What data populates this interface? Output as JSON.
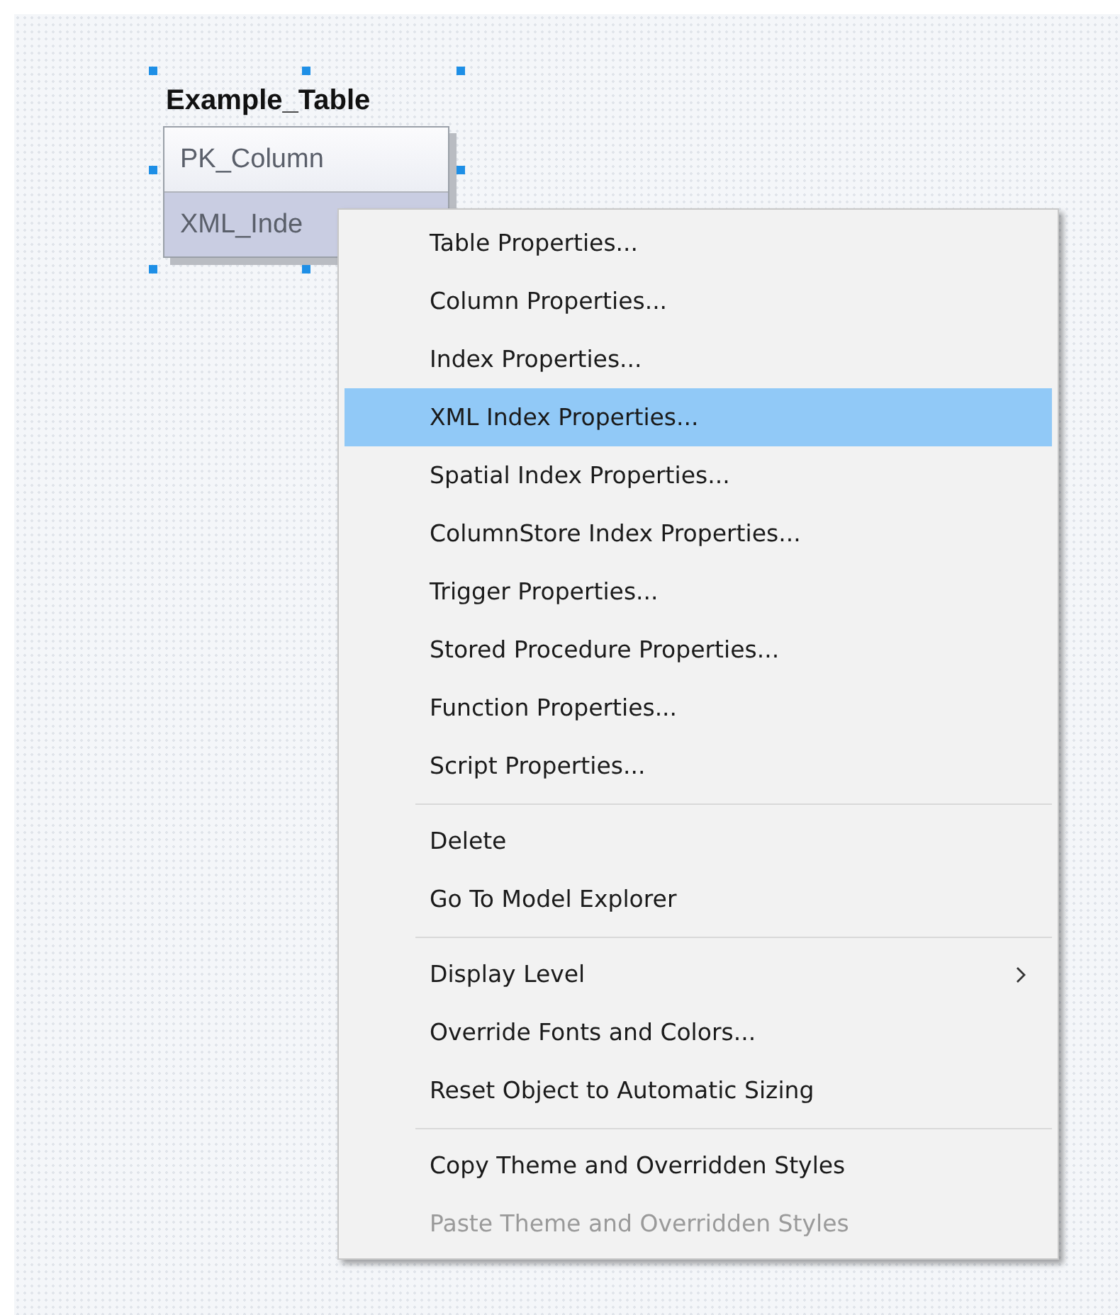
{
  "table": {
    "title": "Example_Table",
    "selected": true,
    "columns": [
      {
        "name": "PK_Column",
        "selected": false
      },
      {
        "name": "XML_Inde",
        "selected": true
      }
    ]
  },
  "context_menu": {
    "groups": [
      [
        {
          "label": "Table Properties...",
          "selected": false,
          "disabled": false,
          "submenu": false
        },
        {
          "label": "Column Properties...",
          "selected": false,
          "disabled": false,
          "submenu": false
        },
        {
          "label": "Index Properties...",
          "selected": false,
          "disabled": false,
          "submenu": false
        },
        {
          "label": "XML Index Properties...",
          "selected": true,
          "disabled": false,
          "submenu": false
        },
        {
          "label": "Spatial Index Properties...",
          "selected": false,
          "disabled": false,
          "submenu": false
        },
        {
          "label": "ColumnStore Index Properties...",
          "selected": false,
          "disabled": false,
          "submenu": false
        },
        {
          "label": "Trigger Properties...",
          "selected": false,
          "disabled": false,
          "submenu": false
        },
        {
          "label": "Stored Procedure Properties...",
          "selected": false,
          "disabled": false,
          "submenu": false
        },
        {
          "label": "Function Properties...",
          "selected": false,
          "disabled": false,
          "submenu": false
        },
        {
          "label": "Script Properties...",
          "selected": false,
          "disabled": false,
          "submenu": false
        }
      ],
      [
        {
          "label": "Delete",
          "selected": false,
          "disabled": false,
          "submenu": false
        },
        {
          "label": "Go To Model Explorer",
          "selected": false,
          "disabled": false,
          "submenu": false
        }
      ],
      [
        {
          "label": "Display Level",
          "selected": false,
          "disabled": false,
          "submenu": true
        },
        {
          "label": "Override Fonts and Colors...",
          "selected": false,
          "disabled": false,
          "submenu": false
        },
        {
          "label": "Reset Object to Automatic Sizing",
          "selected": false,
          "disabled": false,
          "submenu": false
        }
      ],
      [
        {
          "label": "Copy Theme and Overridden Styles",
          "selected": false,
          "disabled": false,
          "submenu": false
        },
        {
          "label": "Paste Theme and Overridden Styles",
          "selected": false,
          "disabled": true,
          "submenu": false
        }
      ]
    ]
  }
}
